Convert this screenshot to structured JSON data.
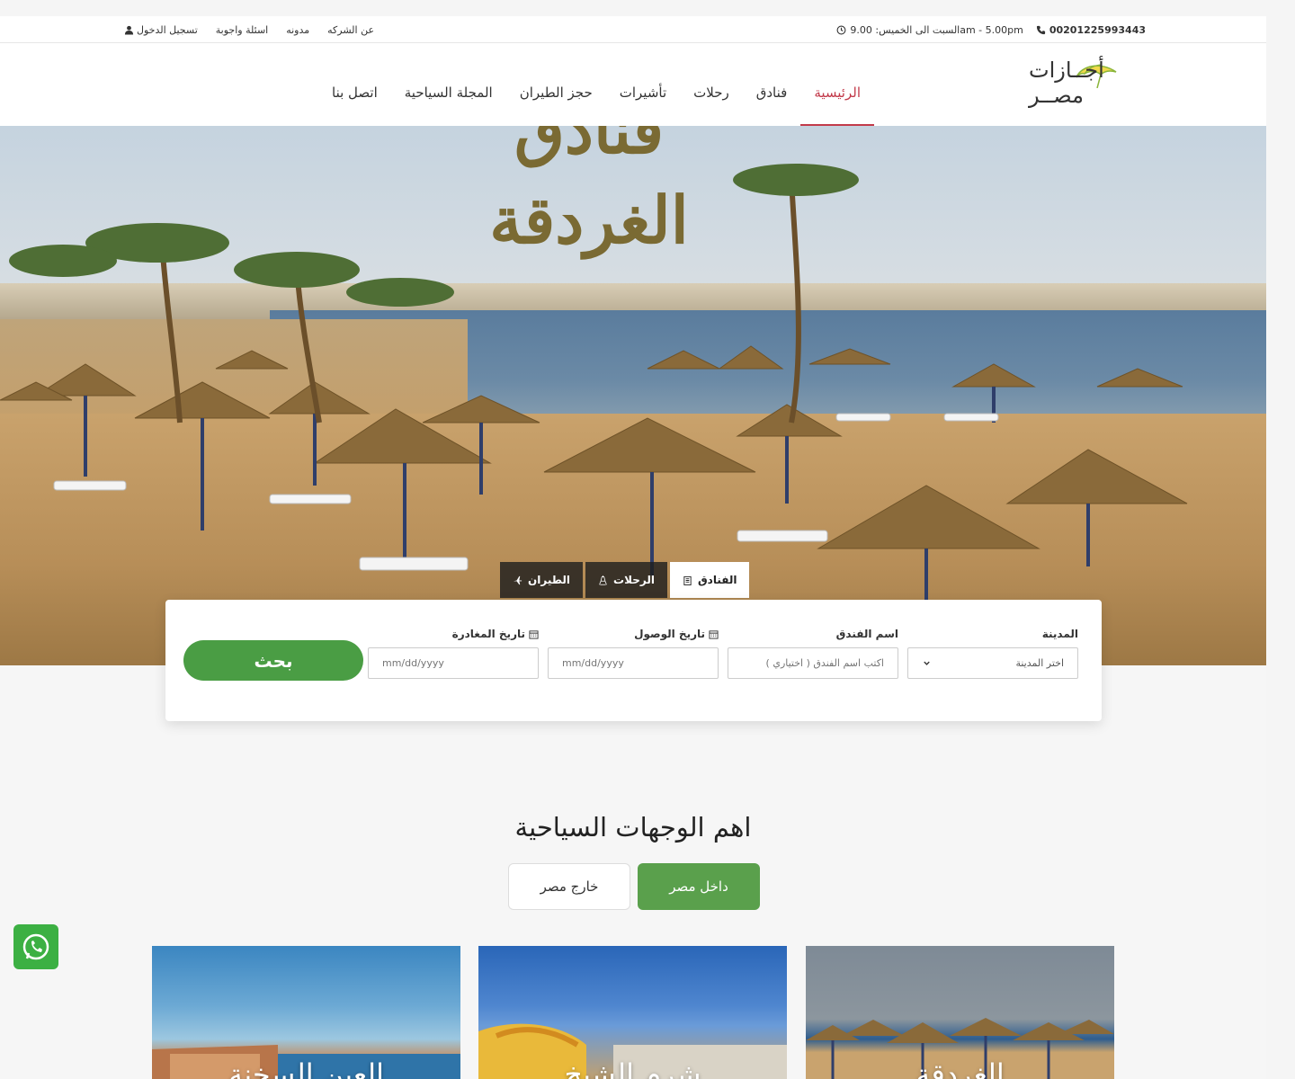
{
  "topbar": {
    "phone": "00201225993443",
    "hours": "السبت الى الخميس: 9.00am - 5.00pm",
    "links": [
      "عن الشركه",
      "مدونه",
      "اسئلة واجوبة"
    ],
    "login": "تسجيل الدخول"
  },
  "header": {
    "logo_text": "أجــازات مصــر",
    "nav": [
      {
        "label": "الرئيسية",
        "active": true
      },
      {
        "label": "فنادق"
      },
      {
        "label": "رحلات"
      },
      {
        "label": "تأشيرات"
      },
      {
        "label": "حجز الطيران"
      },
      {
        "label": "المجلة السياحية"
      },
      {
        "label": "اتصل بنا"
      }
    ]
  },
  "hero": {
    "title_line1": "فنادق",
    "title_line2": "الغردقة"
  },
  "search": {
    "tabs": [
      {
        "label": "الفنادق",
        "icon": "hotel-icon",
        "active": true
      },
      {
        "label": "الرحلات",
        "icon": "eiffel-icon"
      },
      {
        "label": "الطيران",
        "icon": "plane-icon"
      }
    ],
    "city_label": "المدينة",
    "city_value": "اختر المدينة",
    "hotel_label": "اسم الفندق",
    "hotel_placeholder": "اكتب اسم الفندق ( اختياري )",
    "arrival_label": "تاريخ الوصول",
    "arrival_placeholder": "mm/dd/yyyy",
    "departure_label": "تاريخ المغادرة",
    "departure_placeholder": "mm/dd/yyyy",
    "button": "بحث"
  },
  "destinations": {
    "title": "اهم الوجهات السياحية",
    "tabs": [
      {
        "label": "داخل مصر",
        "active": true
      },
      {
        "label": "خارج مصر"
      }
    ],
    "cards": [
      "الغردقة",
      "شرم الشيخ",
      "العين السخنة"
    ]
  },
  "colors": {
    "accent": "#c23a4a",
    "green": "#4a9d44",
    "tab_dark": "#1e1e1e"
  }
}
